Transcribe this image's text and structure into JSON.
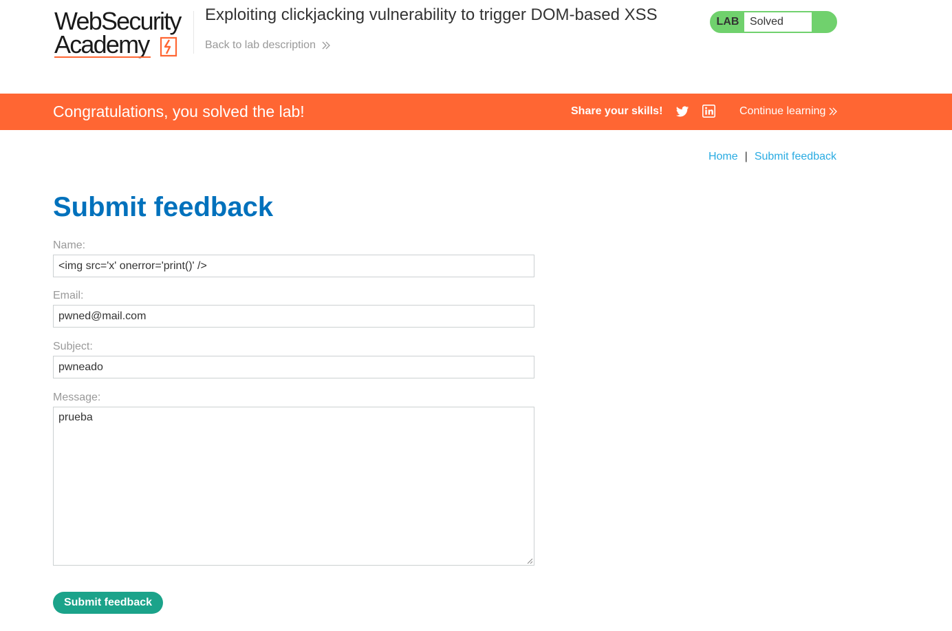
{
  "header": {
    "logo": {
      "line1": "WebSecurity",
      "line2": "Academy"
    },
    "lab_title": "Exploiting clickjacking vulnerability to trigger DOM-based XSS",
    "back_link": "Back to lab description",
    "status": {
      "badge": "LAB",
      "text": "Solved"
    }
  },
  "banner": {
    "message": "Congratulations, you solved the lab!",
    "share_label": "Share your skills!",
    "icons": [
      "twitter-icon",
      "linkedin-icon"
    ],
    "continue_link": "Continue learning"
  },
  "breadcrumb": {
    "home": "Home",
    "separator": "|",
    "current": "Submit feedback"
  },
  "form": {
    "title": "Submit feedback",
    "name": {
      "label": "Name:",
      "value": "<img src='x' onerror='print()' />"
    },
    "email": {
      "label": "Email:",
      "value": "pwned@mail.com"
    },
    "subject": {
      "label": "Subject:",
      "value": "pwneado"
    },
    "message": {
      "label": "Message:",
      "value": "prueba"
    },
    "submit_label": "Submit feedback"
  },
  "colors": {
    "brand_orange": "#ff6633",
    "solved_green": "#70d16d",
    "title_blue": "#0071bc",
    "link_blue": "#29abe2",
    "button_teal": "#1ba38a"
  }
}
